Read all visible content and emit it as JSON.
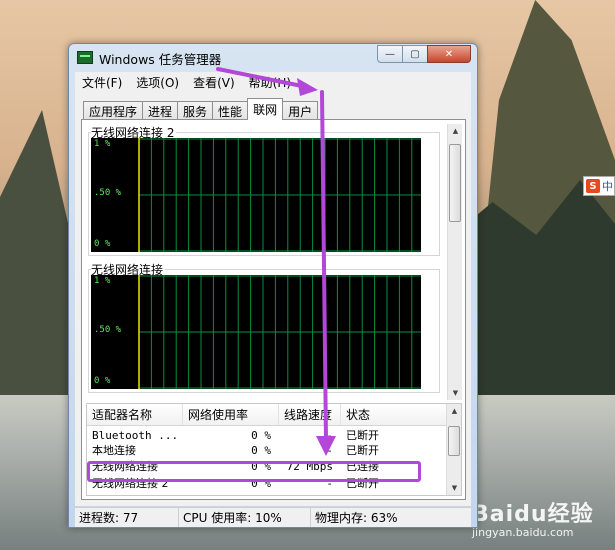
{
  "window": {
    "title": "Windows 任务管理器",
    "buttons": {
      "minimize": "—",
      "maximize": "▢",
      "close": "✕"
    }
  },
  "menu": [
    "文件(F)",
    "选项(O)",
    "查看(V)",
    "帮助(H)"
  ],
  "tabs": [
    {
      "label": "应用程序",
      "active": false
    },
    {
      "label": "进程",
      "active": false
    },
    {
      "label": "服务",
      "active": false
    },
    {
      "label": "性能",
      "active": false
    },
    {
      "label": "联网",
      "active": true
    },
    {
      "label": "用户",
      "active": false
    }
  ],
  "graphs": [
    {
      "title": "无线网络连接 2",
      "ticks": [
        "1 %",
        ".50 %",
        "0 %"
      ]
    },
    {
      "title": "无线网络连接",
      "ticks": [
        "1 %",
        ".50 %",
        "0 %"
      ]
    }
  ],
  "table": {
    "headers": [
      "适配器名称",
      "网络使用率",
      "线路速度",
      "状态"
    ],
    "rows": [
      {
        "name": "Bluetooth ...",
        "usage": "0 %",
        "speed": "-",
        "status": "已断开"
      },
      {
        "name": "本地连接",
        "usage": "0 %",
        "speed": "-",
        "status": "已断开"
      },
      {
        "name": "无线网络连接",
        "usage": "0 %",
        "speed": "72 Mbps",
        "status": "已连接"
      },
      {
        "name": "无线网络连接 2",
        "usage": "0 %",
        "speed": "-",
        "status": "已断开"
      }
    ]
  },
  "status": {
    "processes": "进程数: 77",
    "cpu": "CPU 使用率: 10%",
    "memory": "物理内存: 63%"
  },
  "ime": {
    "logo": "S",
    "mode": "中"
  },
  "watermark": {
    "brand": "Baidu经验",
    "url": "jingyan.baidu.com"
  },
  "colors": {
    "annotation": "#b247d8",
    "graph_bg": "#000000",
    "graph_grid": "#0b8f3c",
    "graph_line": "#e8e800",
    "tick_text": "#5fe35f"
  },
  "icons": [
    "task-manager-icon",
    "ime-sogou-icon"
  ]
}
